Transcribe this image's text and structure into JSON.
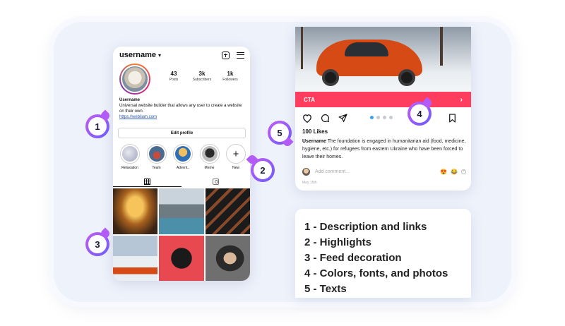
{
  "profile": {
    "username": "username",
    "stats": [
      {
        "number": "43",
        "label": "Posts"
      },
      {
        "number": "3k",
        "label": "Subscribers"
      },
      {
        "number": "1k",
        "label": "Followers"
      }
    ],
    "bio_name": "Username",
    "bio_text": "Universal website builder that allows any user to create a website on their own.",
    "bio_link": "https://weblium.com",
    "edit_profile_label": "Edit profile",
    "highlights": [
      {
        "label": "Relaxation",
        "color": "#b9bccb"
      },
      {
        "label": "Team",
        "color": "#4a6b8f"
      },
      {
        "label": "Advent..",
        "color": "#e0a83a"
      },
      {
        "label": "Meme",
        "color": "#5b5b5b"
      }
    ],
    "new_highlight_label": "New",
    "new_highlight_glyph": "+"
  },
  "post": {
    "cta_label": "CTA",
    "cta_arrow": "›",
    "likes": "100 Likes",
    "caption_user": "Username",
    "caption_text": "The foundation is engaged in humanitarian aid (food, medicine, hygiene, etc.) for refugees from eastern Ukraine who have been forced to leave their homes.",
    "comment_placeholder": "Add comment...",
    "emojis": [
      "😍",
      "😂"
    ],
    "comment_plus": "+",
    "date": "May 15th"
  },
  "legend": [
    "1 - Description and links",
    "2 - Highlights",
    "3 - Feed decoration",
    "4 - Colors, fonts, and photos",
    "5 - Texts"
  ],
  "markers": [
    "1",
    "2",
    "3",
    "4",
    "5"
  ],
  "colors": {
    "cta": "#ff3e5f",
    "marker_gradient_start": "#c25cf5",
    "marker_gradient_end": "#6b5cff",
    "link": "#2b56c9",
    "frame_bg": "#eef2fb"
  }
}
